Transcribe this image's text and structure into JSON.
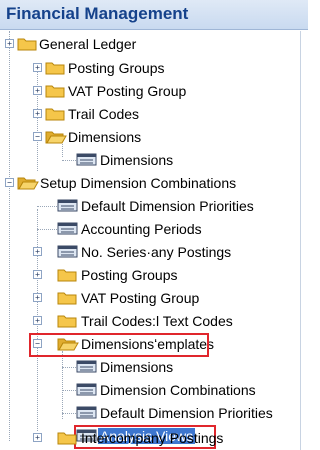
{
  "header": {
    "title": "Financial Management"
  },
  "tree": {
    "items": [
      {
        "label": "General Ledger",
        "type": "folder",
        "expander": "+"
      },
      {
        "label": "Posting Groups",
        "type": "folder",
        "expander": "+"
      },
      {
        "label": "VAT Posting Group",
        "type": "folder",
        "expander": "+"
      },
      {
        "label": "Trail Codes",
        "type": "folder",
        "expander": "+"
      },
      {
        "label": "Dimensions",
        "type": "open-folder",
        "expander": "-"
      },
      {
        "label": "Dimensions",
        "type": "list"
      },
      {
        "label": "Setup  Dimension Combinations",
        "type": "open-folder",
        "expander": "-"
      },
      {
        "label": "Default Dimension Priorities",
        "type": "list"
      },
      {
        "label": "Accounting Periods",
        "type": "list"
      },
      {
        "label": "No. Series·any Postings",
        "type": "list",
        "expander": "+"
      },
      {
        "label": "Posting Groups",
        "type": "folder",
        "expander": "+"
      },
      {
        "label": "VAT Posting Group",
        "type": "folder",
        "expander": "+"
      },
      {
        "label": "Trail Codes:l Text Codes",
        "type": "folder",
        "expander": "+"
      },
      {
        "label": "Dimensionsʻemplates",
        "type": "open-folder",
        "expander": "-"
      },
      {
        "label": "Dimensions",
        "type": "list"
      },
      {
        "label": "Dimension Combinations",
        "type": "list"
      },
      {
        "label": "Default Dimension Priorities",
        "type": "list"
      },
      {
        "label": "Analysis Views",
        "type": "list",
        "selected": true
      },
      {
        "label": "Intercompany Postings",
        "type": "folder",
        "expander": "+"
      }
    ]
  },
  "colors": {
    "accent": "#15428b",
    "selection": "#3d76cf",
    "highlight": "#e0262c"
  }
}
